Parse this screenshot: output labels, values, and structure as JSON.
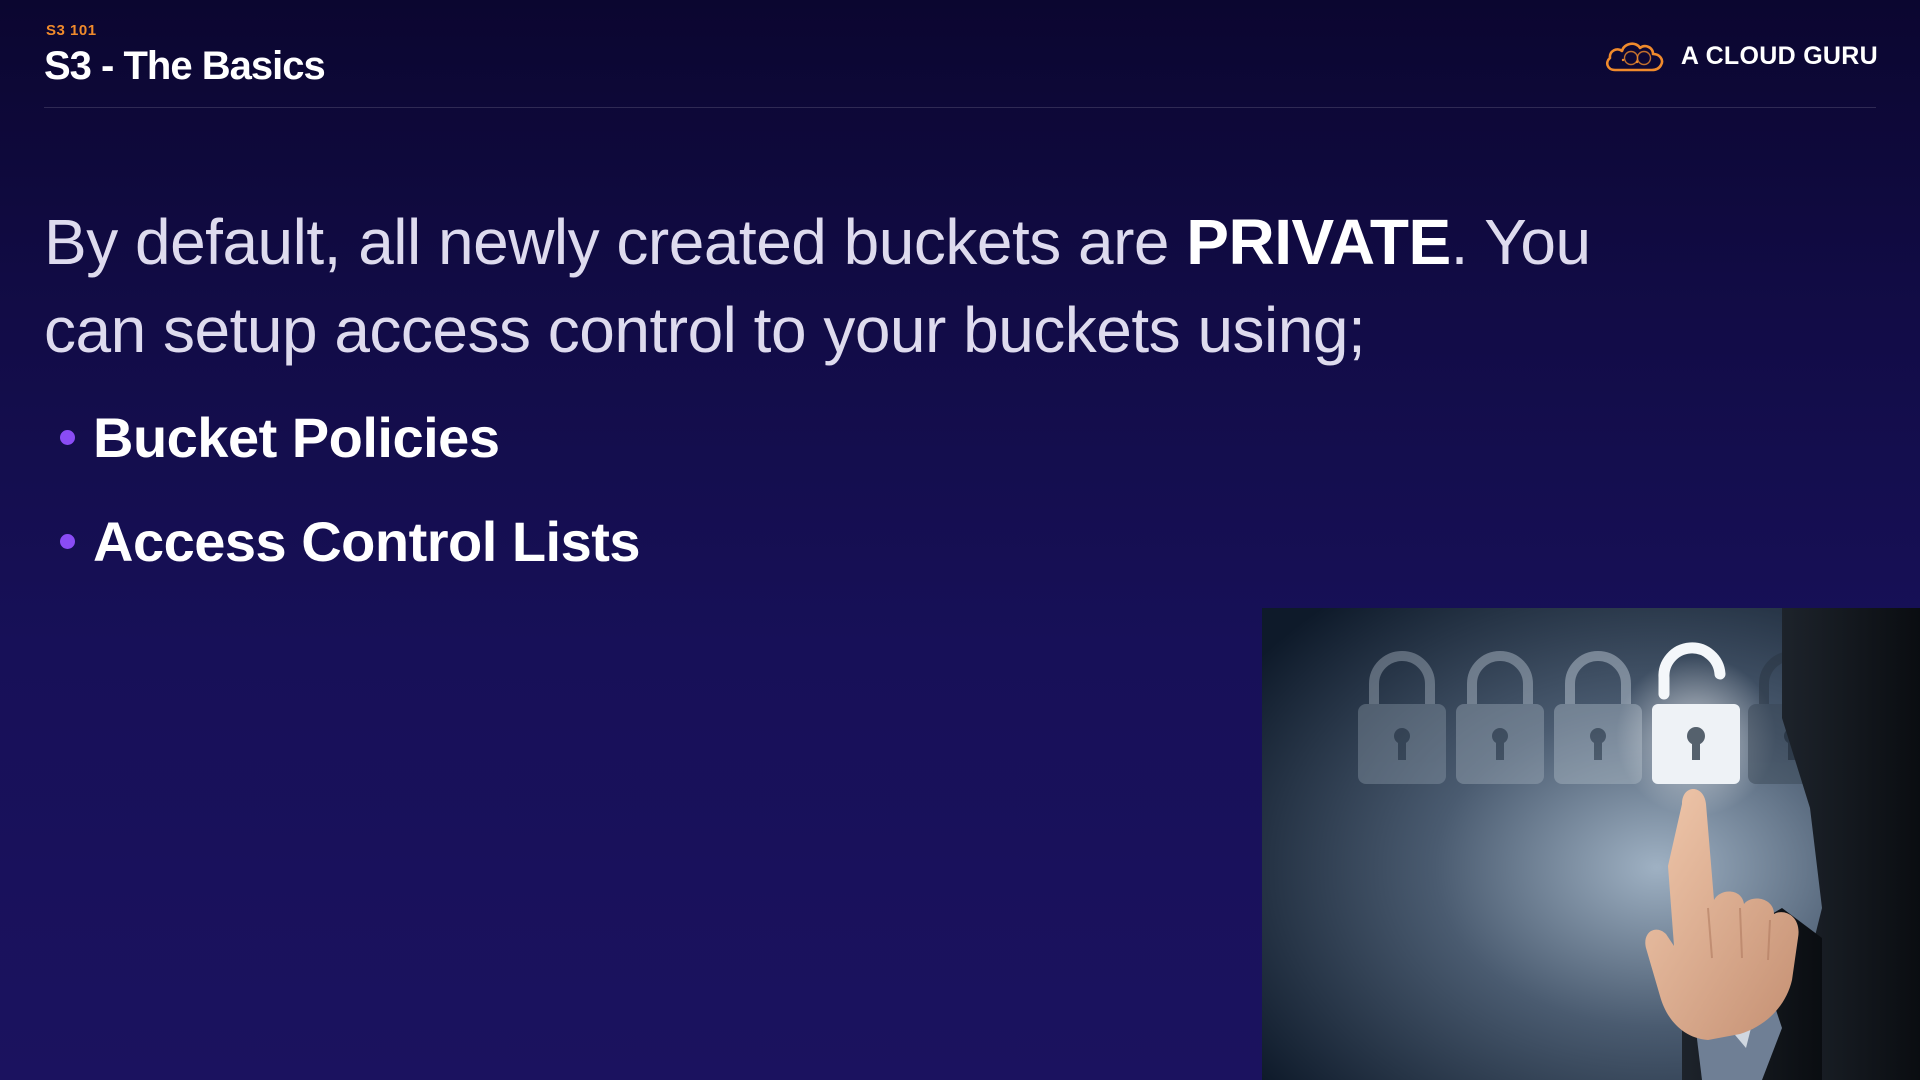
{
  "header": {
    "eyebrow": "S3 101",
    "title": "S3 - The Basics"
  },
  "brand": {
    "name": "A CLOUD GURU",
    "logo_icon": "cloud-logo-icon",
    "logo_color": "#f08a2c"
  },
  "body": {
    "intro_before": "By default, all newly created buckets are ",
    "intro_emphasis": "PRIVATE",
    "intro_after": ". You can setup access control to your buckets using;",
    "bullets": [
      {
        "label": "Bucket Policies"
      },
      {
        "label": "Access Control Lists"
      }
    ]
  },
  "colors": {
    "background_top": "#0b0630",
    "background_bottom": "#1b125f",
    "accent_orange": "#f08a2c",
    "bullet_purple": "#8a4cf5"
  },
  "image": {
    "subject": "hand-touching-unlocked-padlock",
    "icons": [
      "padlock-icon",
      "unlocked-padlock-icon"
    ]
  }
}
